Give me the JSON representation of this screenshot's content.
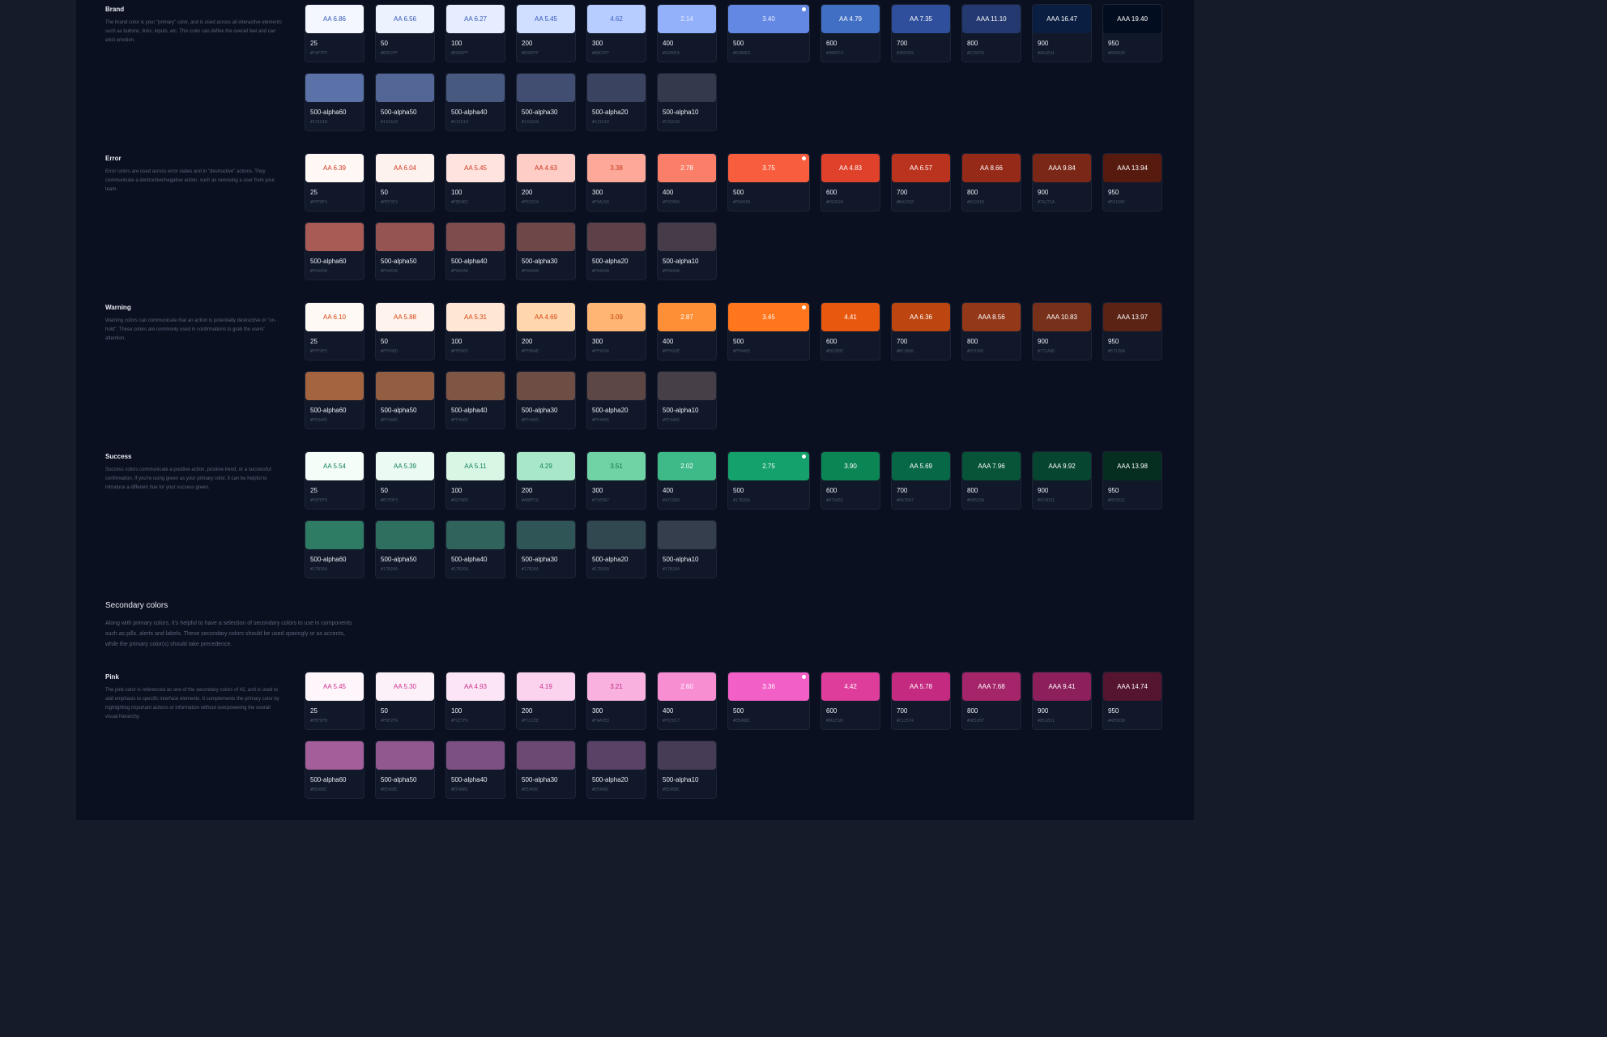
{
  "secondary": {
    "title": "Secondary colors",
    "description": "Along with primary colors, it's helpful to have a selection of secondary colors to use in components such as pills, alerts and labels. These secondary colors should be used sparingly or as accents, while the primary color(s) should take precedence."
  },
  "groups": [
    {
      "id": "brand",
      "title": "Brand",
      "description": "The brand color is your \"primary\" color, and is used across all interactive elements such as buttons, links, inputs, etc. This color can define the overall feel and can elicit emotion.",
      "solid": [
        {
          "name": "25",
          "hex": "#F4F7FF",
          "ratio": "AA 6.86",
          "bg": "#F4F7FF",
          "fg": "#3158b8"
        },
        {
          "name": "50",
          "hex": "#EDF2FF",
          "ratio": "AA 6.56",
          "bg": "#EDF2FF",
          "fg": "#3158b8"
        },
        {
          "name": "100",
          "hex": "#E6EDFF",
          "ratio": "AA 6.27",
          "bg": "#E6EDFF",
          "fg": "#3158b8"
        },
        {
          "name": "200",
          "hex": "#D0DEFF",
          "ratio": "AA 5.45",
          "bg": "#D0DEFF",
          "fg": "#3158b8"
        },
        {
          "name": "300",
          "hex": "#B8CDFF",
          "ratio": "4.62",
          "bg": "#B8CDFF",
          "fg": "#3a5fc0"
        },
        {
          "name": "400",
          "hex": "#9280FA",
          "ratio": "2.14",
          "bg": "#93B0FA",
          "fg": "#e8efff"
        },
        {
          "name": "500",
          "hex": "#6388E3",
          "ratio": "3.40",
          "bg": "#6388E3",
          "fg": "#eef3ff",
          "dot": true
        },
        {
          "name": "600",
          "hex": "#406FC3",
          "ratio": "AA 4.79",
          "bg": "#406FC3",
          "fg": "#ffffff"
        },
        {
          "name": "700",
          "hex": "#365399",
          "ratio": "AA 7.35",
          "bg": "#2F4E9B",
          "fg": "#ffffff"
        },
        {
          "name": "800",
          "hex": "#233970",
          "ratio": "AAA 11.10",
          "bg": "#233970",
          "fg": "#ffffff"
        },
        {
          "name": "900",
          "hex": "#0A1E41",
          "ratio": "AAA 16.47",
          "bg": "#0A1E41",
          "fg": "#ffffff"
        },
        {
          "name": "950",
          "hex": "#030D20",
          "ratio": "AAA 19.40",
          "bg": "#030D20",
          "fg": "#ffffff"
        }
      ],
      "alpha": [
        {
          "name": "500-alpha60",
          "hex": "#131618",
          "bg": "#5B72A8"
        },
        {
          "name": "500-alpha50",
          "hex": "#131618",
          "bg": "#526796"
        },
        {
          "name": "500-alpha40",
          "hex": "#131618",
          "bg": "#48597F"
        },
        {
          "name": "500-alpha30",
          "hex": "#131618",
          "bg": "#414E71"
        },
        {
          "name": "500-alpha20",
          "hex": "#131618",
          "bg": "#3A4360"
        },
        {
          "name": "500-alpha10",
          "hex": "#131618",
          "bg": "#343A4C"
        }
      ]
    },
    {
      "id": "error",
      "title": "Error",
      "description": "Error colors are used across error states and in \"destructive\" actions. They communicate a destructive/negative action, such as removing a user from your team.",
      "solid": [
        {
          "name": "25",
          "hex": "#FFF8F4",
          "ratio": "AA 6.39",
          "bg": "#FFF8F5",
          "fg": "#d0381f"
        },
        {
          "name": "50",
          "hex": "#FEF3F2",
          "ratio": "AA 6.04",
          "bg": "#FEF2EF",
          "fg": "#d0381f"
        },
        {
          "name": "100",
          "hex": "#FEE4E2",
          "ratio": "AA 5.45",
          "bg": "#FEE3DF",
          "fg": "#d0381f"
        },
        {
          "name": "200",
          "hex": "#FECDCA",
          "ratio": "AA 4.63",
          "bg": "#FECDC6",
          "fg": "#c8361d"
        },
        {
          "name": "300",
          "hex": "#F0A298",
          "ratio": "3.38",
          "bg": "#FDA898",
          "fg": "#c8361d"
        },
        {
          "name": "400",
          "hex": "#F97066",
          "ratio": "2.78",
          "bg": "#FB7E68",
          "fg": "#ffffff"
        },
        {
          "name": "500",
          "hex": "#F04438",
          "ratio": "3.75",
          "bg": "#F85E3D",
          "fg": "#ffffff",
          "dot": true
        },
        {
          "name": "600",
          "hex": "#D92D20",
          "ratio": "AA 4.83",
          "bg": "#E0412A",
          "fg": "#ffffff"
        },
        {
          "name": "700",
          "hex": "#B42318",
          "ratio": "AA 6.57",
          "bg": "#BA331E",
          "fg": "#ffffff"
        },
        {
          "name": "800",
          "hex": "#912018",
          "ratio": "AA 8.66",
          "bg": "#962A19",
          "fg": "#ffffff"
        },
        {
          "name": "900",
          "hex": "#7A271A",
          "ratio": "AAA 9.84",
          "bg": "#7A2717",
          "fg": "#ffffff"
        },
        {
          "name": "950",
          "hex": "#55160C",
          "ratio": "AAA 13.94",
          "bg": "#561A0E",
          "fg": "#ffffff"
        }
      ],
      "alpha": [
        {
          "name": "500-alpha60",
          "hex": "#F04438",
          "bg": "#A85A54"
        },
        {
          "name": "500-alpha50",
          "hex": "#F04438",
          "bg": "#955451"
        },
        {
          "name": "500-alpha40",
          "hex": "#F04438",
          "bg": "#7F4C4D"
        },
        {
          "name": "500-alpha30",
          "hex": "#F04438",
          "bg": "#6E4749"
        },
        {
          "name": "500-alpha20",
          "hex": "#F04438",
          "bg": "#5C4148"
        },
        {
          "name": "500-alpha10",
          "hex": "#F04438",
          "bg": "#463C49"
        }
      ]
    },
    {
      "id": "warning",
      "title": "Warning",
      "description": "Warning colors can communicate that an action is potentially destructive or \"on-hold\". These colors are commonly used in confirmations to grab the users' attention.",
      "solid": [
        {
          "name": "25",
          "hex": "#FFF9F5",
          "ratio": "AA 6.10",
          "bg": "#FFF9F5",
          "fg": "#d44410"
        },
        {
          "name": "50",
          "hex": "#FFF4ED",
          "ratio": "AA 5.88",
          "bg": "#FFF4ED",
          "fg": "#d44410"
        },
        {
          "name": "100",
          "hex": "#FFE6D5",
          "ratio": "AA 5.31",
          "bg": "#FFE6D5",
          "fg": "#d44410"
        },
        {
          "name": "200",
          "hex": "#FFD6AE",
          "ratio": "AA 4.69",
          "bg": "#FFD6AE",
          "fg": "#d44410"
        },
        {
          "name": "300",
          "hex": "#FF9C66",
          "ratio": "3.09",
          "bg": "#FFB573",
          "fg": "#c9420e"
        },
        {
          "name": "400",
          "hex": "#FF692E",
          "ratio": "2.87",
          "bg": "#FF8F36",
          "fg": "#ffffff"
        },
        {
          "name": "500",
          "hex": "#FF4405",
          "ratio": "3.45",
          "bg": "#FF761C",
          "fg": "#ffffff",
          "dot": true
        },
        {
          "name": "600",
          "hex": "#E62E05",
          "ratio": "4.41",
          "bg": "#E8590F",
          "fg": "#ffffff"
        },
        {
          "name": "700",
          "hex": "#BC1B06",
          "ratio": "AA 6.36",
          "bg": "#BC4510",
          "fg": "#ffffff"
        },
        {
          "name": "800",
          "hex": "#97180C",
          "ratio": "AAA 8.56",
          "bg": "#93391A",
          "fg": "#ffffff"
        },
        {
          "name": "900",
          "hex": "#771A0D",
          "ratio": "AAA 10.83",
          "bg": "#77301A",
          "fg": "#ffffff"
        },
        {
          "name": "950",
          "hex": "#57130A",
          "ratio": "AAA 13.97",
          "bg": "#5A2314",
          "fg": "#ffffff"
        }
      ],
      "alpha": [
        {
          "name": "500-alpha60",
          "hex": "#FF4405",
          "bg": "#A46440"
        },
        {
          "name": "500-alpha50",
          "hex": "#FF4405",
          "bg": "#935D42"
        },
        {
          "name": "500-alpha40",
          "hex": "#FF4405",
          "bg": "#7F5544"
        },
        {
          "name": "500-alpha30",
          "hex": "#FF4405",
          "bg": "#6E4E44"
        },
        {
          "name": "500-alpha20",
          "hex": "#FF4405",
          "bg": "#5C4745"
        },
        {
          "name": "500-alpha10",
          "hex": "#FF4405",
          "bg": "#473F48"
        }
      ]
    },
    {
      "id": "success",
      "title": "Success",
      "description": "Success colors communicate a positive action, positive trend, or a successful confirmation. If you're using green as your primary color, it can be helpful to introduce a different hue for your success green.",
      "solid": [
        {
          "name": "25",
          "hex": "#F6FEF9",
          "ratio": "AA 5.54",
          "bg": "#F5FDF8",
          "fg": "#12805b"
        },
        {
          "name": "50",
          "hex": "#ECFDF3",
          "ratio": "AA 5.39",
          "bg": "#EBFBF3",
          "fg": "#12805b"
        },
        {
          "name": "100",
          "hex": "#DCFAE6",
          "ratio": "AA 5.11",
          "bg": "#D8F6E4",
          "fg": "#12805b"
        },
        {
          "name": "200",
          "hex": "#ABEFC6",
          "ratio": "4.29",
          "bg": "#A8E8C8",
          "fg": "#12805b"
        },
        {
          "name": "300",
          "hex": "#75E0A7",
          "ratio": "3.51",
          "bg": "#6FD3A5",
          "fg": "#0f7252"
        },
        {
          "name": "400",
          "hex": "#47CD89",
          "ratio": "2.02",
          "bg": "#3EBA88",
          "fg": "#ffffff"
        },
        {
          "name": "500",
          "hex": "#17B26A",
          "ratio": "2.75",
          "bg": "#14A16B",
          "fg": "#ffffff",
          "dot": true
        },
        {
          "name": "600",
          "hex": "#079455",
          "ratio": "3.90",
          "bg": "#0C8555",
          "fg": "#ffffff"
        },
        {
          "name": "700",
          "hex": "#067647",
          "ratio": "AA 5.69",
          "bg": "#076847",
          "fg": "#ffffff"
        },
        {
          "name": "800",
          "hex": "#085D3A",
          "ratio": "AAA 7.96",
          "bg": "#075439",
          "fg": "#ffffff"
        },
        {
          "name": "900",
          "hex": "#074D31",
          "ratio": "AAA 9.92",
          "bg": "#06452F",
          "fg": "#ffffff"
        },
        {
          "name": "950",
          "hex": "#053321",
          "ratio": "AAA 13.98",
          "bg": "#052E20",
          "fg": "#ffffff"
        }
      ],
      "alpha": [
        {
          "name": "500-alpha60",
          "hex": "#17B26A",
          "bg": "#2F7C65"
        },
        {
          "name": "500-alpha50",
          "hex": "#17B26A",
          "bg": "#2E6F60"
        },
        {
          "name": "500-alpha40",
          "hex": "#17B26A",
          "bg": "#2F635B"
        },
        {
          "name": "500-alpha30",
          "hex": "#17B26A",
          "bg": "#305556"
        },
        {
          "name": "500-alpha20",
          "hex": "#17B26A",
          "bg": "#324851"
        },
        {
          "name": "500-alpha10",
          "hex": "#17B26A",
          "bg": "#343E4C"
        }
      ]
    },
    {
      "id": "pink",
      "title": "Pink",
      "description": "The pink color is referenced as one of the secondary colors of 42, and is used to add emphasis to specific interface elements. It complements the primary color by highlighting important actions or information without overpowering the overall visual hierarchy.",
      "solid": [
        {
          "name": "25",
          "hex": "#FEF6FB",
          "ratio": "AA 5.45",
          "bg": "#FEF6FB",
          "fg": "#cf2e8f"
        },
        {
          "name": "50",
          "hex": "#FDF2FA",
          "ratio": "AA 5.30",
          "bg": "#FDF1F9",
          "fg": "#cf2e8f"
        },
        {
          "name": "100",
          "hex": "#FCE7F6",
          "ratio": "AA 4.93",
          "bg": "#FCE6F5",
          "fg": "#cf2e8f"
        },
        {
          "name": "200",
          "hex": "#FCCCEE",
          "ratio": "4.19",
          "bg": "#FCD3EE",
          "fg": "#c82b89"
        },
        {
          "name": "300",
          "hex": "#FAA7E0",
          "ratio": "3.21",
          "bg": "#F9B1DF",
          "fg": "#c02a84"
        },
        {
          "name": "400",
          "hex": "#F670C7",
          "ratio": "2.60",
          "bg": "#F78ED2",
          "fg": "#ffffff"
        },
        {
          "name": "500",
          "hex": "#EE46BC",
          "ratio": "3.36",
          "bg": "#F25FC6",
          "fg": "#ffffff",
          "dot": true
        },
        {
          "name": "600",
          "hex": "#DD2590",
          "ratio": "4.42",
          "bg": "#DE3D9C",
          "fg": "#ffffff"
        },
        {
          "name": "700",
          "hex": "#C11574",
          "ratio": "AA 5.78",
          "bg": "#C42B80",
          "fg": "#ffffff"
        },
        {
          "name": "800",
          "hex": "#9E165F",
          "ratio": "AAA 7.68",
          "bg": "#A4256A",
          "fg": "#ffffff"
        },
        {
          "name": "900",
          "hex": "#851651",
          "ratio": "AAA 9.41",
          "bg": "#8C1F5C",
          "fg": "#ffffff"
        },
        {
          "name": "950",
          "hex": "#4E0D30",
          "ratio": "AAA 14.74",
          "bg": "#55142F",
          "fg": "#ffffff"
        }
      ],
      "alpha": [
        {
          "name": "500-alpha60",
          "hex": "#EE46BC",
          "bg": "#A45E9A"
        },
        {
          "name": "500-alpha50",
          "hex": "#EE46BC",
          "bg": "#915890"
        },
        {
          "name": "500-alpha40",
          "hex": "#EE46BC",
          "bg": "#7C5082"
        },
        {
          "name": "500-alpha30",
          "hex": "#EE46BC",
          "bg": "#6B4973"
        },
        {
          "name": "500-alpha20",
          "hex": "#EE46BC",
          "bg": "#594265"
        },
        {
          "name": "500-alpha10",
          "hex": "#EE46BC",
          "bg": "#463C55"
        }
      ]
    }
  ]
}
